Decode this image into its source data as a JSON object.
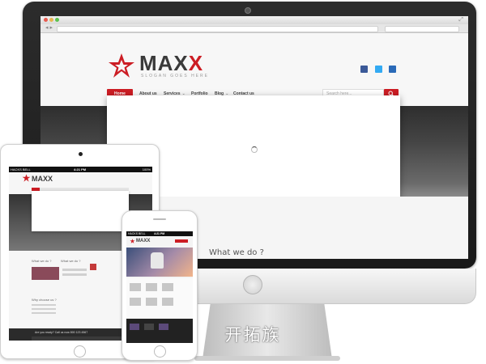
{
  "watermark": "开拓族",
  "browser": {
    "search_placeholder": ""
  },
  "site": {
    "logo": {
      "name_plain": "MAX",
      "name_accent": "X",
      "slogan": "SLOGAN GOES HERE"
    },
    "social_icons": [
      "facebook-icon",
      "twitter-icon",
      "delicious-icon"
    ],
    "nav": {
      "items": [
        {
          "label": "Home",
          "active": true
        },
        {
          "label": "About us",
          "active": false
        },
        {
          "label": "Services",
          "active": false,
          "has_dropdown": true
        },
        {
          "label": "Portfolio",
          "active": false
        },
        {
          "label": "Blog",
          "active": false,
          "has_dropdown": true
        },
        {
          "label": "Contact us",
          "active": false
        }
      ],
      "search_placeholder": "Search here..."
    },
    "section_title": "What we do ?"
  },
  "ipad": {
    "status": {
      "carrier": "HACKS BELL",
      "time": "4:21 PM",
      "battery": "100%"
    },
    "logo": "MAXX",
    "what_we_do": "What we do ?",
    "why_choose": "Why choose us ?",
    "footer_text": "Are you ready? Call us now 800 123 4567"
  },
  "iphone": {
    "status": {
      "carrier": "HACKS BELL",
      "time": "4:21 PM"
    },
    "logo": "MAXX"
  },
  "colors": {
    "accent_red": "#cc1d24",
    "dark_band": "#3a3a3a",
    "facebook": "#3b5998",
    "twitter": "#33aaf3",
    "delicious": "#2a6ab8"
  }
}
